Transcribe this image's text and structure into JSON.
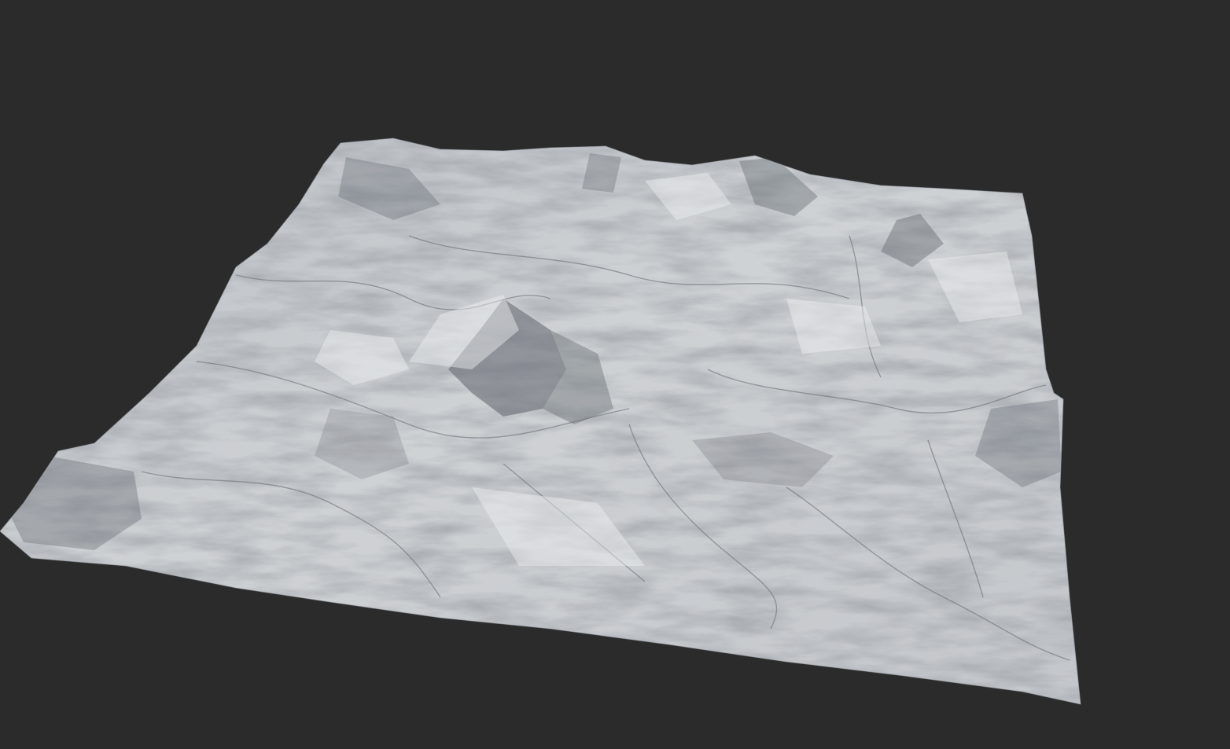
{
  "viewport": {
    "background_color": "#2b2b2b",
    "terrain_base_color": "#c9ccd0",
    "terrain_shadow_color": "#4a4e55",
    "terrain_highlight_color": "#e6e8ea",
    "content": "heightfield-terrain-render"
  }
}
